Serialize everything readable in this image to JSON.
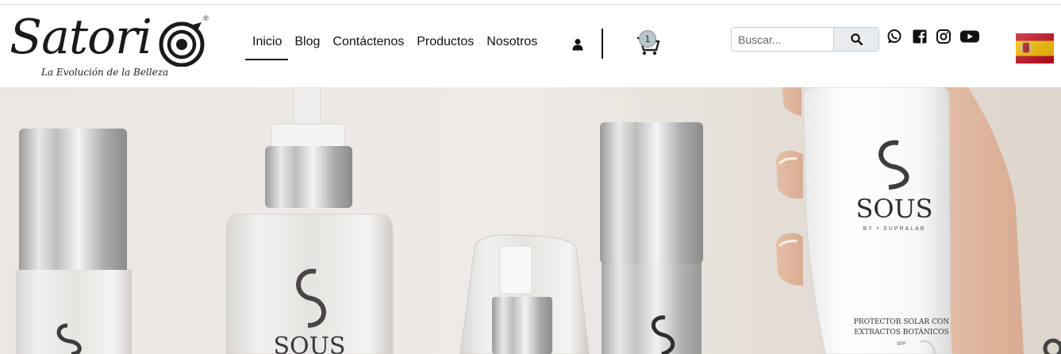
{
  "brand": {
    "name": "Satori",
    "tagline": "La Evolución de la Belleza",
    "registered": "®"
  },
  "nav": {
    "items": [
      {
        "label": "Inicio",
        "active": true
      },
      {
        "label": "Blog"
      },
      {
        "label": "Contáctenos"
      },
      {
        "label": "Productos"
      },
      {
        "label": "Nosotros"
      }
    ]
  },
  "cart": {
    "count": "1"
  },
  "search": {
    "placeholder": "Buscar..."
  },
  "social": [
    "whatsapp-icon",
    "facebook-icon",
    "instagram-icon",
    "youtube-icon"
  ],
  "language": {
    "flag": "spain-flag-icon"
  },
  "hero": {
    "product_brand": "SOUS",
    "product_sub": "BY • SUPRALAB",
    "product_label_line1": "PROTECTOR SOLAR CON",
    "product_label_line2": "EXTRACTOS BOTÁNICOS",
    "product_spf": "SPF",
    "bottle_brand": "SOUS"
  },
  "colors": {
    "text": "#111111",
    "hero_bg": "#ece7e2",
    "silver": "#c8c8c8"
  }
}
